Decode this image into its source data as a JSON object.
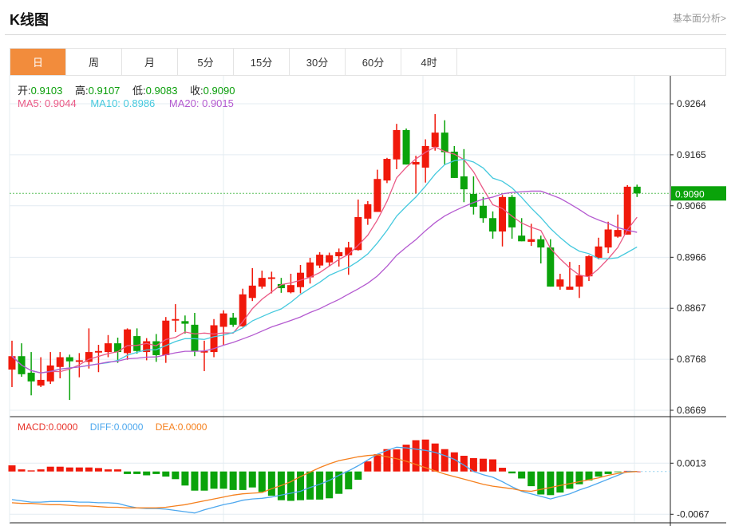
{
  "header": {
    "title": "K线图",
    "link": "基本面分析>"
  },
  "tabs": [
    {
      "label": "日",
      "active": true
    },
    {
      "label": "周"
    },
    {
      "label": "月"
    },
    {
      "label": "5分"
    },
    {
      "label": "15分"
    },
    {
      "label": "30分"
    },
    {
      "label": "60分"
    },
    {
      "label": "4时"
    }
  ],
  "ohlc": {
    "open_label": "开:",
    "open": "0.9103",
    "high_label": "高:",
    "high": "0.9107",
    "low_label": "低:",
    "low": "0.9083",
    "close_label": "收:",
    "close": "0.9090"
  },
  "ma": {
    "ma5": "MA5: 0.9044",
    "ma10": "MA10: 0.8986",
    "ma20": "MA20: 0.9015"
  },
  "macd_legend": {
    "macd": "MACD:0.0000",
    "diff": "DIFF:0.0000",
    "dea": "DEA:0.0000"
  },
  "colors": {
    "up": "#f0190b",
    "down": "#0aa30a",
    "ma5": "#ea5a86",
    "ma10": "#45c9de",
    "ma20": "#b45ad0",
    "diff": "#4ea8ee",
    "dea": "#f5801e",
    "active_tab": "#f28c3c"
  },
  "chart_data": [
    {
      "type": "candlestick",
      "title": "K线图",
      "y_ticks": [
        "0.9264",
        "0.9165",
        "0.9066",
        "0.8966",
        "0.8867",
        "0.8768",
        "0.8669"
      ],
      "ylim": [
        0.8669,
        0.9264
      ],
      "current_price": "0.9090",
      "ohlc_fields": [
        "open",
        "close",
        "high",
        "low"
      ],
      "candles": [
        [
          0.8748,
          0.8774,
          0.8804,
          0.8714
        ],
        [
          0.8774,
          0.8739,
          0.8799,
          0.8734
        ],
        [
          0.8742,
          0.8725,
          0.8782,
          0.8698
        ],
        [
          0.8717,
          0.8728,
          0.8772,
          0.8714
        ],
        [
          0.8725,
          0.8756,
          0.8782,
          0.872
        ],
        [
          0.8753,
          0.8772,
          0.8782,
          0.8731
        ],
        [
          0.8772,
          0.8764,
          0.8777,
          0.8689
        ],
        [
          0.8763,
          0.8766,
          0.878,
          0.8733
        ],
        [
          0.8763,
          0.8782,
          0.8828,
          0.875
        ],
        [
          0.8781,
          0.8784,
          0.8796,
          0.8743
        ],
        [
          0.8782,
          0.8799,
          0.8815,
          0.8772
        ],
        [
          0.8799,
          0.8782,
          0.881,
          0.8761
        ],
        [
          0.878,
          0.8826,
          0.8828,
          0.8767
        ],
        [
          0.8813,
          0.8784,
          0.8828,
          0.8779
        ],
        [
          0.8782,
          0.8803,
          0.8809,
          0.8766
        ],
        [
          0.8803,
          0.8776,
          0.8817,
          0.8763
        ],
        [
          0.8776,
          0.8843,
          0.885,
          0.8761
        ],
        [
          0.8843,
          0.8846,
          0.8875,
          0.8821
        ],
        [
          0.8842,
          0.8837,
          0.8853,
          0.8818
        ],
        [
          0.8835,
          0.8784,
          0.8858,
          0.8774
        ],
        [
          0.8781,
          0.8784,
          0.8804,
          0.8745
        ],
        [
          0.8782,
          0.8834,
          0.8846,
          0.8772
        ],
        [
          0.8831,
          0.8857,
          0.8863,
          0.8796
        ],
        [
          0.8849,
          0.8835,
          0.8858,
          0.8831
        ],
        [
          0.8832,
          0.8894,
          0.8905,
          0.8831
        ],
        [
          0.8887,
          0.8911,
          0.8945,
          0.8881
        ],
        [
          0.8909,
          0.8926,
          0.894,
          0.8905
        ],
        [
          0.8924,
          0.8927,
          0.8938,
          0.8896
        ],
        [
          0.8914,
          0.8906,
          0.8926,
          0.8897
        ],
        [
          0.8898,
          0.8912,
          0.8934,
          0.8896
        ],
        [
          0.8908,
          0.8936,
          0.8951,
          0.8896
        ],
        [
          0.8927,
          0.8956,
          0.8965,
          0.8915
        ],
        [
          0.895,
          0.8971,
          0.8976,
          0.8945
        ],
        [
          0.8956,
          0.897,
          0.8975,
          0.8948
        ],
        [
          0.8968,
          0.8976,
          0.8983,
          0.8948
        ],
        [
          0.897,
          0.8985,
          0.8996,
          0.8932
        ],
        [
          0.898,
          0.9044,
          0.9078,
          0.8979
        ],
        [
          0.9041,
          0.9069,
          0.9075,
          0.9029
        ],
        [
          0.9054,
          0.9118,
          0.9136,
          0.9054
        ],
        [
          0.9115,
          0.9157,
          0.9159,
          0.911
        ],
        [
          0.9156,
          0.9213,
          0.9225,
          0.9137
        ],
        [
          0.9213,
          0.9146,
          0.9216,
          0.9146
        ],
        [
          0.9146,
          0.9151,
          0.9163,
          0.909
        ],
        [
          0.914,
          0.9182,
          0.9195,
          0.9111
        ],
        [
          0.918,
          0.9208,
          0.9244,
          0.9173
        ],
        [
          0.9208,
          0.917,
          0.9232,
          0.9145
        ],
        [
          0.9171,
          0.912,
          0.9182,
          0.912
        ],
        [
          0.9123,
          0.9098,
          0.9176,
          0.9073
        ],
        [
          0.9089,
          0.9064,
          0.9123,
          0.9049
        ],
        [
          0.9066,
          0.9042,
          0.9083,
          0.9033
        ],
        [
          0.9042,
          0.9016,
          0.9055,
          0.9002
        ],
        [
          0.9016,
          0.9083,
          0.9087,
          0.8987
        ],
        [
          0.9083,
          0.9024,
          0.9087,
          0.9002
        ],
        [
          0.9008,
          0.8997,
          0.9042,
          0.8997
        ],
        [
          0.8996,
          0.9001,
          0.9031,
          0.8988
        ],
        [
          0.9001,
          0.8985,
          0.9008,
          0.8954
        ],
        [
          0.8985,
          0.8909,
          0.9001,
          0.8909
        ],
        [
          0.8909,
          0.8923,
          0.8934,
          0.8903
        ],
        [
          0.8903,
          0.8909,
          0.8957,
          0.8903
        ],
        [
          0.8909,
          0.8931,
          0.8951,
          0.8887
        ],
        [
          0.8929,
          0.8968,
          0.897,
          0.892
        ],
        [
          0.8965,
          0.8987,
          0.9004,
          0.8962
        ],
        [
          0.8985,
          0.902,
          0.9035,
          0.8974
        ],
        [
          0.9006,
          0.9019,
          0.9049,
          0.9004
        ],
        [
          0.901,
          0.9103,
          0.9106,
          0.901
        ],
        [
          0.9103,
          0.909,
          0.9107,
          0.9083
        ]
      ],
      "moving_averages": [
        "MA5",
        "MA10",
        "MA20"
      ]
    },
    {
      "type": "bar+line",
      "title": "MACD",
      "y_ticks": [
        "0.0013",
        "-0.0067"
      ],
      "value_unit": 0.0001,
      "hist": [
        9.6,
        3.3,
        1.7,
        3.3,
        7.5,
        7.5,
        6.3,
        6.3,
        6.3,
        5.4,
        3.3,
        3.3,
        -4,
        -4,
        -6,
        -4,
        -8,
        -12,
        -22,
        -30,
        -30,
        -27,
        -27,
        -29,
        -29,
        -25,
        -32,
        -38,
        -45,
        -46,
        -45,
        -44,
        -44,
        -42,
        -35,
        -28,
        -13,
        15.8,
        27,
        35,
        34.6,
        42,
        49,
        50,
        43.8,
        35,
        30,
        24.6,
        21,
        20,
        19,
        5.8,
        -3,
        -11,
        -23,
        -36,
        -37,
        -33,
        -27,
        -20,
        -14,
        -8,
        -4,
        -1,
        1,
        0
      ],
      "diff": [
        -44,
        -46,
        -48,
        -48,
        -47,
        -47,
        -47,
        -48,
        -48,
        -49,
        -49,
        -50,
        -54,
        -57,
        -58,
        -58,
        -59,
        -61,
        -63,
        -65,
        -60,
        -56,
        -52,
        -49,
        -45,
        -43,
        -42,
        -40,
        -37,
        -34,
        -31,
        -25,
        -20,
        -14,
        -6,
        1,
        9,
        18,
        27,
        33,
        38,
        37,
        35,
        33,
        30,
        25,
        19,
        10,
        0,
        -5,
        -9,
        -16,
        -24,
        -31,
        -35,
        -39,
        -43,
        -39,
        -35,
        -29,
        -24,
        -18,
        -12,
        -6,
        0,
        0
      ],
      "dea": [
        -49,
        -50,
        -50,
        -51,
        -52,
        -52,
        -53,
        -54,
        -54,
        -55,
        -56,
        -56,
        -57,
        -57,
        -57,
        -57,
        -56,
        -54,
        -52,
        -49,
        -46,
        -43,
        -40,
        -37,
        -35,
        -34,
        -33,
        -27,
        -22,
        -16,
        -8,
        -1,
        6,
        12,
        17,
        20,
        23,
        25,
        26,
        23,
        20,
        16,
        11,
        6,
        1,
        -4,
        -8,
        -12,
        -16,
        -20,
        -23,
        -25,
        -27,
        -30,
        -31,
        -28,
        -25,
        -22,
        -19,
        -16,
        -13,
        -10,
        -6,
        -3,
        -1,
        0
      ]
    }
  ]
}
